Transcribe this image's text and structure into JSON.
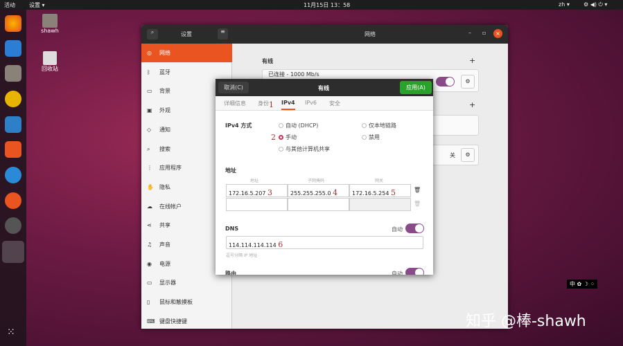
{
  "topbar": {
    "activities": "活动",
    "app_menu": "设置 ▾",
    "clock": "11月15日 13：58",
    "lang": "zh ▾",
    "tray": "⚙ ◀) ⏻ ▾"
  },
  "desktop": {
    "home": "shawh",
    "trash": "回收站"
  },
  "window": {
    "sidebar_title": "设置",
    "title": "网络",
    "sidebar": [
      {
        "icon": "◎",
        "label": "网络"
      },
      {
        "icon": "ᛒ",
        "label": "蓝牙"
      },
      {
        "icon": "▭",
        "label": "背景"
      },
      {
        "icon": "▣",
        "label": "外观"
      },
      {
        "icon": "◇",
        "label": "通知"
      },
      {
        "icon": "⌕",
        "label": "搜索"
      },
      {
        "icon": "⋮",
        "label": "应用程序"
      },
      {
        "icon": "✋",
        "label": "隐私"
      },
      {
        "icon": "☁",
        "label": "在线帐户"
      },
      {
        "icon": "⋖",
        "label": "共享"
      },
      {
        "icon": "♫",
        "label": "声音"
      },
      {
        "icon": "◉",
        "label": "电源"
      },
      {
        "icon": "▭",
        "label": "显示器"
      },
      {
        "icon": "▯",
        "label": "鼠标和触摸板"
      },
      {
        "icon": "⌨",
        "label": "键盘快捷键"
      }
    ],
    "wired_heading": "有线",
    "wired_status": "已连接 - 1000 Mb/s",
    "off_label": "关",
    "plus": "+"
  },
  "dialog": {
    "cancel": "取消(C)",
    "title": "有线",
    "apply": "应用(A)",
    "tabs": [
      "详细信息",
      "身份",
      "IPv4",
      "IPv6",
      "安全"
    ],
    "method_label": "IPv4 方式",
    "methods": [
      "自动 (DHCP)",
      "手动",
      "与其他计算机共享",
      "仅本地链路",
      "禁用"
    ],
    "address_label": "地址",
    "columns": [
      "地址",
      "子网掩码",
      "网关"
    ],
    "address": "172.16.5.207",
    "netmask": "255.255.255.0",
    "gateway": "172.16.5.254",
    "dns_label": "DNS",
    "auto": "自动",
    "dns": "114.114.114.114",
    "dns_hint": "逗号分隔 IP 地址",
    "route_label": "路由"
  },
  "annotations": [
    "1",
    "2",
    "3",
    "4",
    "5",
    "6"
  ],
  "watermark": "知乎 @棒-shawh",
  "input_indicator": "中 ✿ ☽ ⁘"
}
